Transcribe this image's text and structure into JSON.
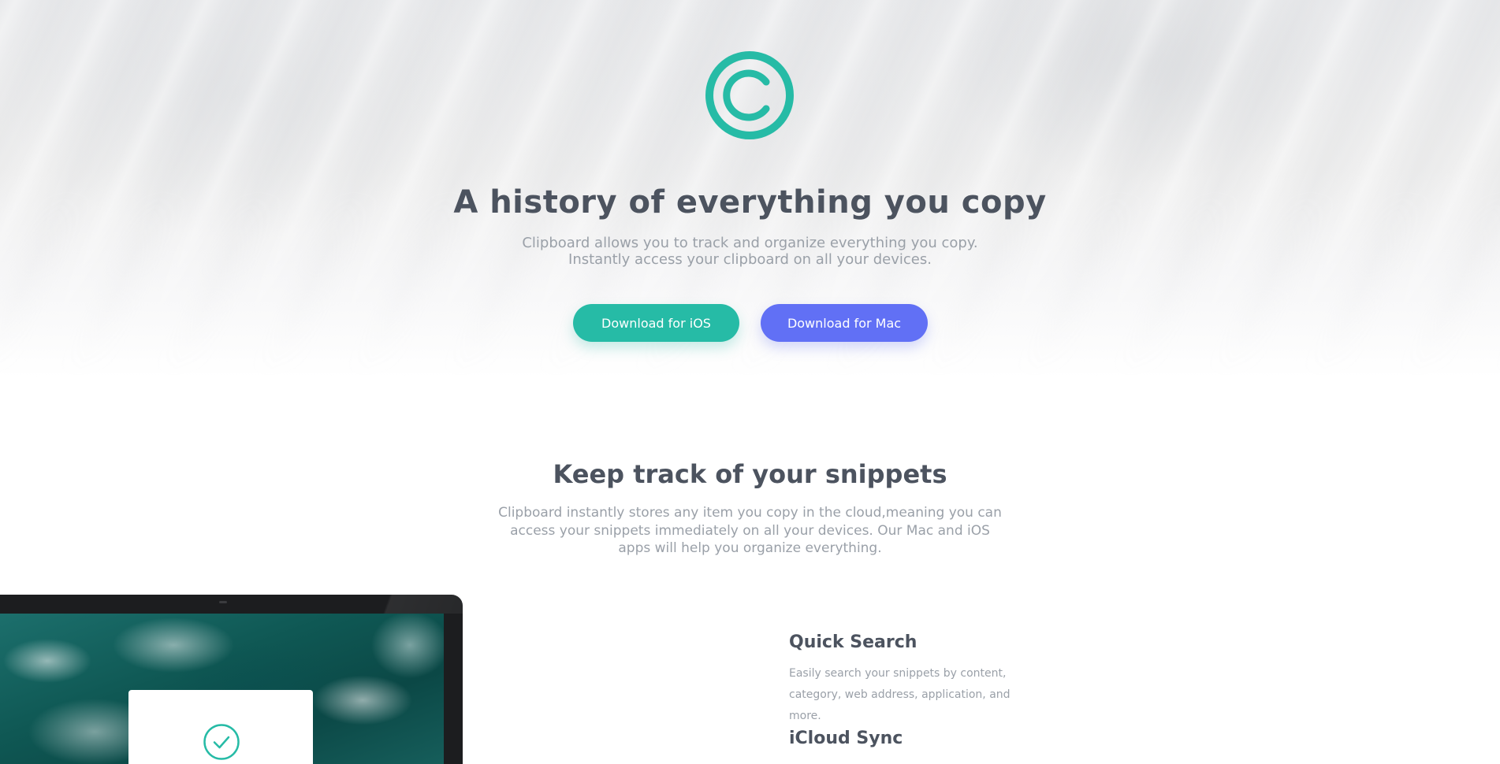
{
  "hero": {
    "title": "A history of everything you copy",
    "subtitle": "Clipboard allows you to track and organize everything you copy. Instantly access your clipboard on all your devices.",
    "buttons": {
      "ios_label": "Download for iOS",
      "mac_label": "Download for Mac"
    },
    "logo_icon": "copyright-icon"
  },
  "snippets": {
    "title": "Keep track of your snippets",
    "subtitle": "Clipboard instantly stores any item you copy in the cloud,meaning you can access your snippets immediately on all your devices. Our Mac and iOS apps will help you organize everything."
  },
  "features": [
    {
      "title": "Quick Search",
      "description": "Easily search your snippets by content, category, web address, application, and more."
    },
    {
      "title": "iCloud Sync"
    }
  ],
  "colors": {
    "accent_green": "#26bba6",
    "accent_blue": "#6170f5",
    "heading": "#4c535f",
    "body_text": "#9aa0a8"
  }
}
